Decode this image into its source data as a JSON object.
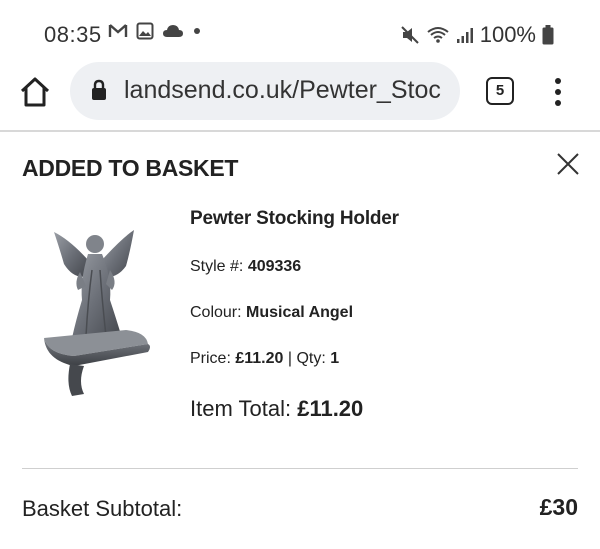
{
  "status_bar": {
    "time": "08:35",
    "left_icons": [
      "gmail-icon",
      "image-icon",
      "cloud-icon",
      "dot-icon"
    ],
    "right_icons": [
      "mute-icon",
      "wifi-icon",
      "signal-icon",
      "battery-icon"
    ],
    "battery": "100%"
  },
  "browser": {
    "url": "landsend.co.uk/Pewter_Stoc",
    "tab_count": "5"
  },
  "modal": {
    "title": "ADDED TO BASKET",
    "product": {
      "name": "Pewter Stocking Holder",
      "style_label": "Style #: ",
      "style_value": "409336",
      "colour_label": "Colour: ",
      "colour_value": "Musical Angel",
      "price_label": "Price: ",
      "price_value": "£11.20",
      "separator": " | ",
      "qty_label": "Qty: ",
      "qty_value": "1",
      "item_total_label": "Item Total: ",
      "item_total_value": "£11.20"
    },
    "subtotal_label": "Basket Subtotal:",
    "subtotal_value": "£30"
  }
}
